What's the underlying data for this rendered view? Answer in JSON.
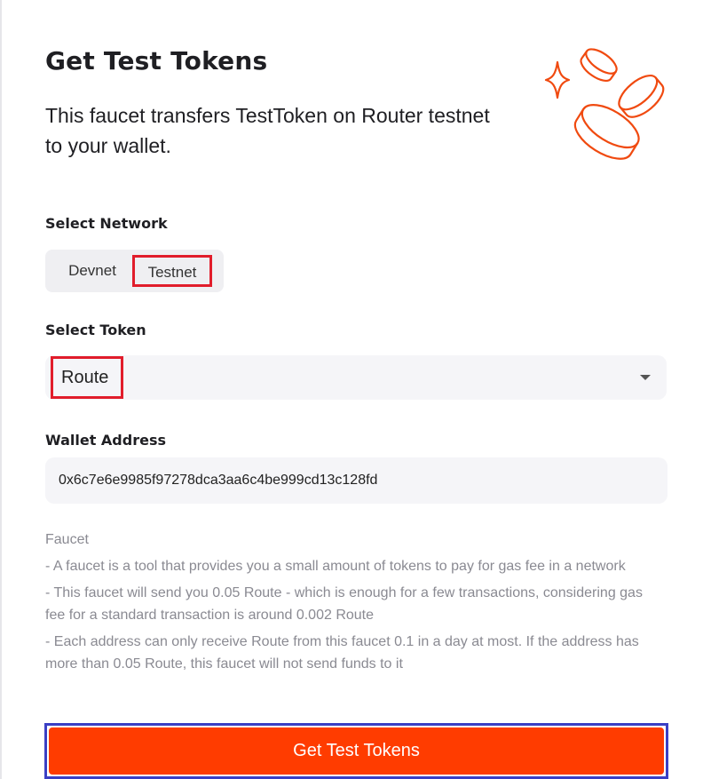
{
  "header": {
    "title": "Get Test Tokens",
    "subtitle": "This faucet transfers TestToken on Router testnet to your wallet."
  },
  "network": {
    "label": "Select Network",
    "options": [
      "Devnet",
      "Testnet"
    ],
    "selected": "Testnet"
  },
  "token": {
    "label": "Select Token",
    "selected": "Route"
  },
  "wallet": {
    "label": "Wallet Address",
    "value": "0x6c7e6e9985f97278dca3aa6c4be999cd13c128fd"
  },
  "info": {
    "heading": "Faucet",
    "lines": [
      "- A faucet is a tool that provides you a small amount of tokens to pay for gas fee in a network",
      "- This faucet will send you 0.05 Route - which is enough for a few transactions, considering gas fee for a standard transaction is around 0.002 Route",
      "- Each address can only receive Route from this faucet 0.1 in a day at most. If the address has more than 0.05 Route, this faucet will not send funds to it"
    ]
  },
  "submit": {
    "label": "Get Test Tokens"
  },
  "colors": {
    "accent": "#ff3c00",
    "highlight_red": "#e11d2b",
    "highlight_blue": "#3b3fc4",
    "muted_text": "#8a8a92"
  },
  "icons": {
    "hero": "coins-sparkle-illustration",
    "caret": "caret-down-icon"
  }
}
